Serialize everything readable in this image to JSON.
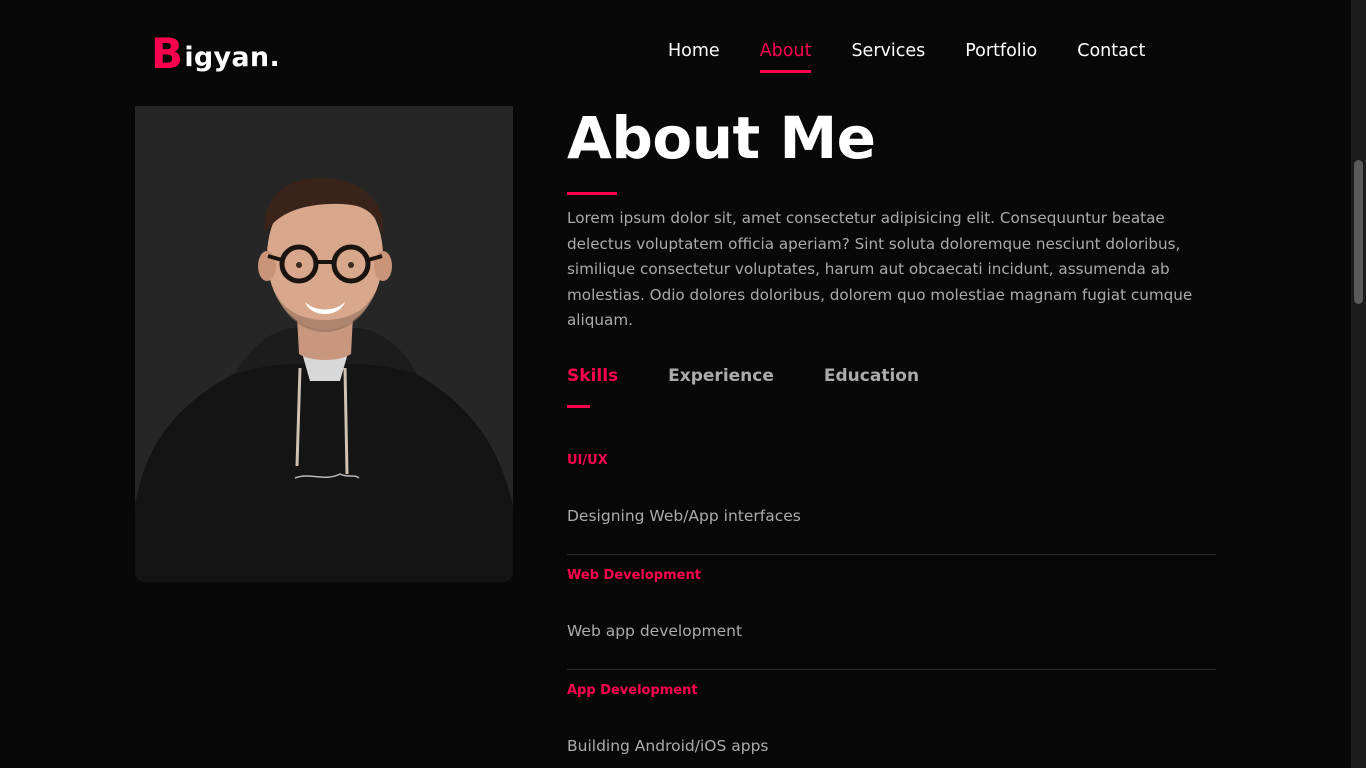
{
  "logo": {
    "first_letter": "B",
    "rest": "igyan."
  },
  "nav": {
    "items": [
      {
        "label": "Home",
        "active": false
      },
      {
        "label": "About",
        "active": true
      },
      {
        "label": "Services",
        "active": false
      },
      {
        "label": "Portfolio",
        "active": false
      },
      {
        "label": "Contact",
        "active": false
      }
    ]
  },
  "about": {
    "title": "About Me",
    "text": "Lorem ipsum dolor sit, amet consectetur adipisicing elit. Consequuntur beatae delectus voluptatem officia aperiam? Sint soluta doloremque nesciunt doloribus, similique consectetur voluptates, harum aut obcaecati incidunt, assumenda ab molestias. Odio dolores doloribus, dolorem quo molestiae magnam fugiat cumque aliquam."
  },
  "tabs": [
    {
      "label": "Skills",
      "active": true
    },
    {
      "label": "Experience",
      "active": false
    },
    {
      "label": "Education",
      "active": false
    }
  ],
  "skills": [
    {
      "title": "UI/UX",
      "description": "Designing Web/App interfaces"
    },
    {
      "title": "Web Development",
      "description": "Web app development"
    },
    {
      "title": "App Development",
      "description": "Building Android/iOS apps"
    }
  ],
  "colors": {
    "accent": "#ff004f",
    "background": "#080808",
    "text": "#ababab",
    "heading": "#ffffff"
  },
  "icons": {
    "profile_photo": "person-photo"
  }
}
